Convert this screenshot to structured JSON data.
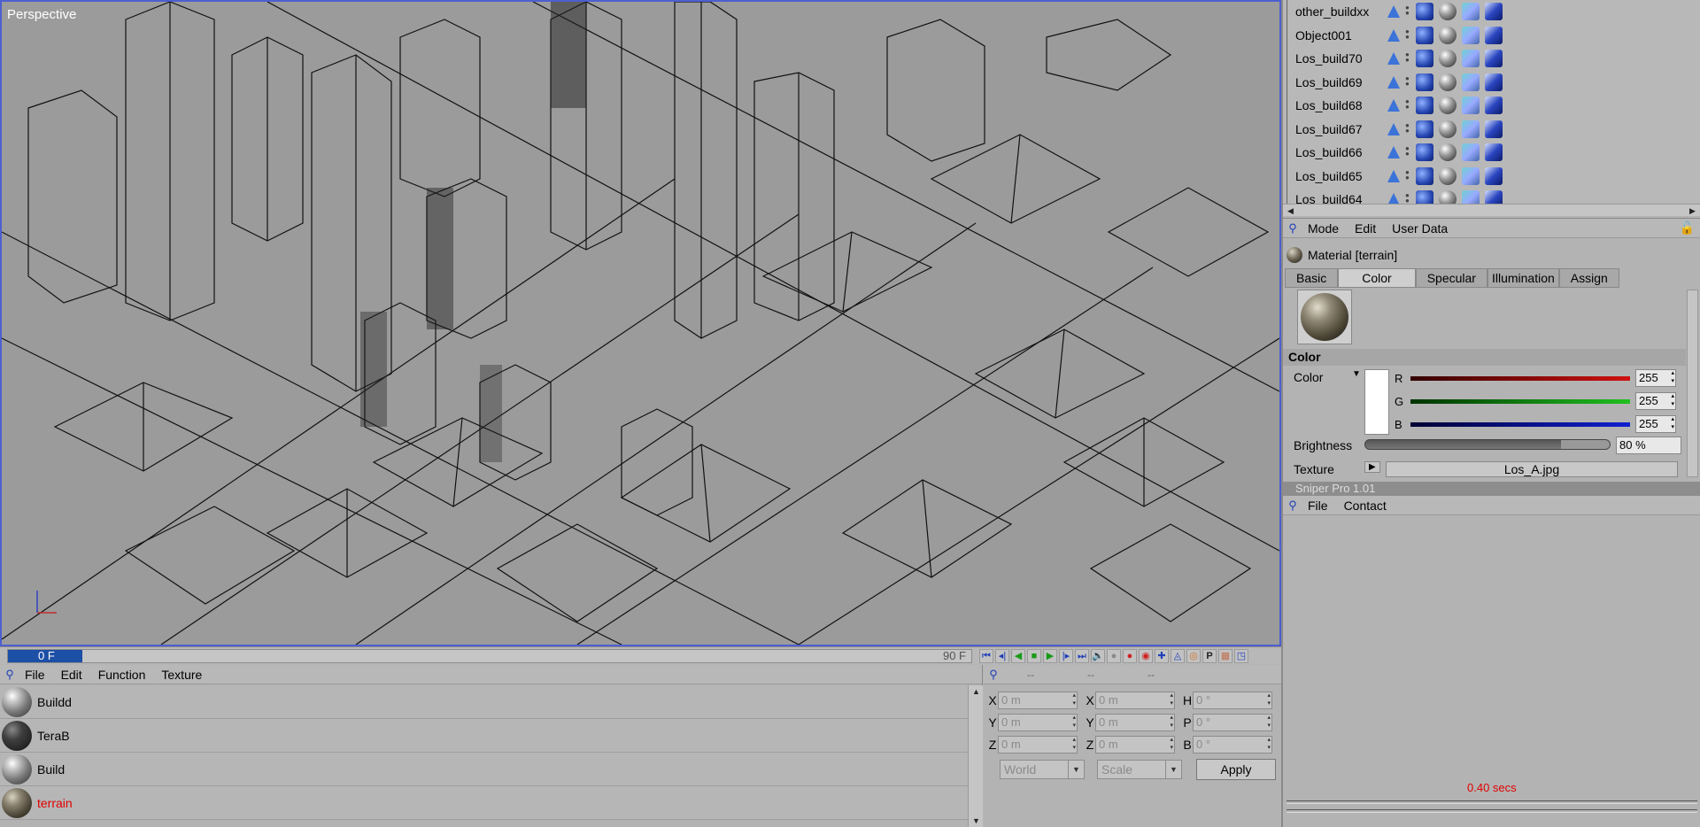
{
  "viewport": {
    "label": "Perspective"
  },
  "timeline": {
    "current_frame": "0 F",
    "end_frame": "90 F"
  },
  "material_manager": {
    "menu": [
      "File",
      "Edit",
      "Function",
      "Texture"
    ],
    "materials": [
      {
        "name": "Buildd",
        "style": "light"
      },
      {
        "name": "TeraB",
        "style": "dark"
      },
      {
        "name": "Build",
        "style": "light"
      },
      {
        "name": "terrain",
        "style": "terrain",
        "selected": true
      }
    ]
  },
  "coordinates": {
    "header_left": "--",
    "header_mid": "--",
    "header_right": "--",
    "position": {
      "x": "0 m",
      "y": "0 m",
      "z": "0 m"
    },
    "scale": {
      "x": "0 m",
      "y": "0 m",
      "z": "0 m"
    },
    "rotation": {
      "h": "0 °",
      "p": "0 °",
      "b": "0 °"
    },
    "axis_labels": {
      "x": "X",
      "y": "Y",
      "z": "Z",
      "h": "H",
      "p": "P",
      "b": "B"
    },
    "mode_select": "World",
    "scale_select": "Scale",
    "apply_label": "Apply"
  },
  "object_manager": {
    "objects": [
      "other_buildxx",
      "Object001",
      "Los_build70",
      "Los_build69",
      "Los_build68",
      "Los_build67",
      "Los_build66",
      "Los_build65",
      "Los_build64"
    ]
  },
  "attributes": {
    "menu": [
      "Mode",
      "Edit",
      "User Data"
    ],
    "title": "Material [terrain]",
    "tabs": [
      "Basic",
      "Color",
      "Specular",
      "Illumination",
      "Assign"
    ],
    "active_tab": "Color",
    "section": "Color",
    "color_label": "Color",
    "channels": [
      {
        "name": "R",
        "value": "255",
        "color": "#d01010"
      },
      {
        "name": "G",
        "value": "255",
        "color": "#20c020"
      },
      {
        "name": "B",
        "value": "255",
        "color": "#1020d0"
      }
    ],
    "brightness_label": "Brightness",
    "brightness_value": "80 %",
    "brightness_fraction": 0.8,
    "texture_label": "Texture",
    "texture_file": "Los_A.jpg"
  },
  "sniper": {
    "title": "Sniper Pro 1.01",
    "menu": [
      "File",
      "Contact"
    ],
    "render_time": "0.40 secs"
  }
}
